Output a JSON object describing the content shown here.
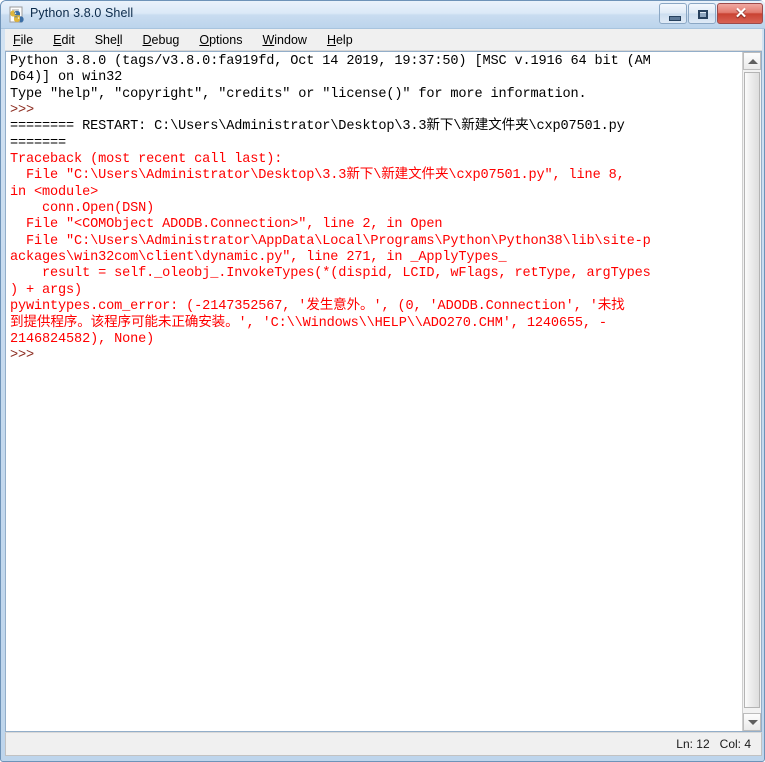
{
  "window": {
    "title": "Python 3.8.0 Shell",
    "icon": "python-idle-icon",
    "controls": {
      "minimize_label": "",
      "maximize_label": "",
      "close_label": "✕"
    }
  },
  "menubar": {
    "items": [
      {
        "label": "File",
        "accel": "F"
      },
      {
        "label": "Edit",
        "accel": "E"
      },
      {
        "label": "Shell",
        "accel": "l"
      },
      {
        "label": "Debug",
        "accel": "D"
      },
      {
        "label": "Options",
        "accel": "O"
      },
      {
        "label": "Window",
        "accel": "W"
      },
      {
        "label": "Help",
        "accel": "H"
      }
    ]
  },
  "console": {
    "lines": [
      {
        "text": "Python 3.8.0 (tags/v3.8.0:fa919fd, Oct 14 2019, 19:37:50) [MSC v.1916 64 bit (AM",
        "style": "black"
      },
      {
        "text": "D64)] on win32",
        "style": "black"
      },
      {
        "text": "Type \"help\", \"copyright\", \"credits\" or \"license()\" for more information.",
        "style": "black"
      },
      {
        "text": ">>> ",
        "style": "prompt"
      },
      {
        "text": "======== RESTART: C:\\Users\\Administrator\\Desktop\\3.3新下\\新建文件夹\\cxp07501.py",
        "style": "black"
      },
      {
        "text": "=======",
        "style": "black"
      },
      {
        "text": "Traceback (most recent call last):",
        "style": "error"
      },
      {
        "text": "  File \"C:\\Users\\Administrator\\Desktop\\3.3新下\\新建文件夹\\cxp07501.py\", line 8,",
        "style": "error"
      },
      {
        "text": "in <module>",
        "style": "error"
      },
      {
        "text": "    conn.Open(DSN)",
        "style": "error"
      },
      {
        "text": "  File \"<COMObject ADODB.Connection>\", line 2, in Open",
        "style": "error"
      },
      {
        "text": "  File \"C:\\Users\\Administrator\\AppData\\Local\\Programs\\Python\\Python38\\lib\\site-p",
        "style": "error"
      },
      {
        "text": "ackages\\win32com\\client\\dynamic.py\", line 271, in _ApplyTypes_",
        "style": "error"
      },
      {
        "text": "    result = self._oleobj_.InvokeTypes(*(dispid, LCID, wFlags, retType, argTypes",
        "style": "error"
      },
      {
        "text": ") + args)",
        "style": "error"
      },
      {
        "text": "pywintypes.com_error: (-2147352567, '发生意外。', (0, 'ADODB.Connection', '未找",
        "style": "error"
      },
      {
        "text": "到提供程序。该程序可能未正确安装。', 'C:\\\\Windows\\\\HELP\\\\ADO270.CHM', 1240655, -",
        "style": "error"
      },
      {
        "text": "2146824582), None)",
        "style": "error"
      },
      {
        "text": ">>> ",
        "style": "prompt"
      }
    ]
  },
  "scrollbar": {
    "up_icon": "scroll-up-arrow",
    "down_icon": "scroll-down-arrow"
  },
  "statusbar": {
    "position": "Ln: 12   Col: 4"
  }
}
